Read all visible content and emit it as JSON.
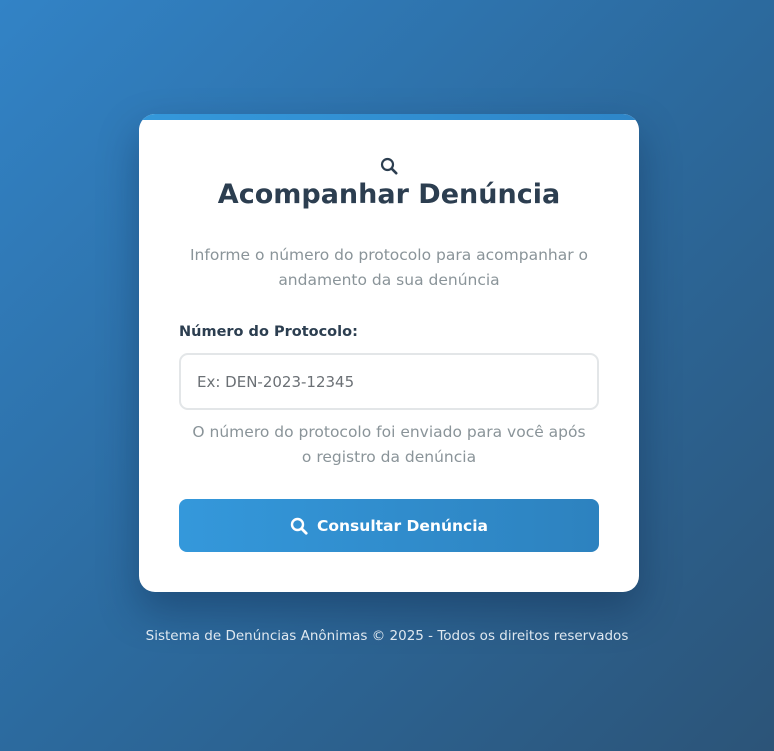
{
  "header": {
    "icon": "search-icon",
    "title": "Acompanhar Denúncia",
    "subtitle": "Informe o número do protocolo para acompanhar o andamento da sua denúncia"
  },
  "form": {
    "protocol_label": "Número do Protocolo:",
    "protocol_value": "",
    "protocol_placeholder": "Ex: DEN-2023-12345",
    "protocol_hint": "O número do protocolo foi enviado para você após o registro da denúncia",
    "submit_icon": "search-icon",
    "submit_label": "Consultar Denúncia"
  },
  "footer": {
    "text": "Sistema de Denúncias Anônimas © 2025 - Todos os direitos reservados"
  },
  "colors": {
    "accent": "#3498db",
    "title": "#2c3e50",
    "muted": "#8a9499",
    "background_start": "#3283c6",
    "background_end": "#2c5478"
  }
}
